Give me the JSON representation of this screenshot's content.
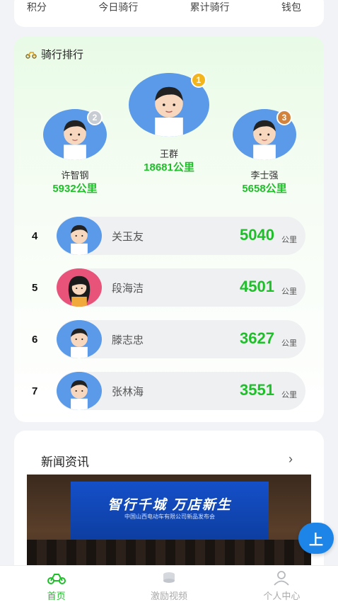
{
  "stats": {
    "points_label": "积分",
    "today_label": "今日骑行",
    "total_label": "累计骑行",
    "wallet_label": "钱包"
  },
  "ranking": {
    "title": "骑行排行",
    "podium": [
      {
        "rank": "1",
        "name": "王群",
        "distance": "18681公里",
        "medal_color": "#f2b51c"
      },
      {
        "rank": "2",
        "name": "许智钢",
        "distance": "5932公里",
        "medal_color": "#c7ccd3"
      },
      {
        "rank": "3",
        "name": "李士强",
        "distance": "5658公里",
        "medal_color": "#d2833e"
      }
    ],
    "list": [
      {
        "rank": "4",
        "name": "关玉友",
        "distance": "5040",
        "unit": "公里"
      },
      {
        "rank": "5",
        "name": "段海洁",
        "distance": "4501",
        "unit": "公里"
      },
      {
        "rank": "6",
        "name": "滕志忠",
        "distance": "3627",
        "unit": "公里"
      },
      {
        "rank": "7",
        "name": "张林海",
        "distance": "3551",
        "unit": "公里"
      }
    ]
  },
  "news": {
    "title": "新闻资讯",
    "more_icon": "chevron-right-icon",
    "image_banner": "智行千城  万店新生",
    "image_subtitle": "中国山西电动车有限公司新品发布会"
  },
  "scroll_top_icon": "arrow-up-icon",
  "tabs": [
    {
      "label": "首页",
      "icon": "scooter-icon",
      "active": true
    },
    {
      "label": "激励视频",
      "icon": "coins-icon",
      "active": false
    },
    {
      "label": "个人中心",
      "icon": "person-icon",
      "active": false
    }
  ],
  "colors": {
    "accent": "#1fbf2a",
    "avatar_bg": "#5b9ae8",
    "scroll_btn": "#1d84e8"
  }
}
